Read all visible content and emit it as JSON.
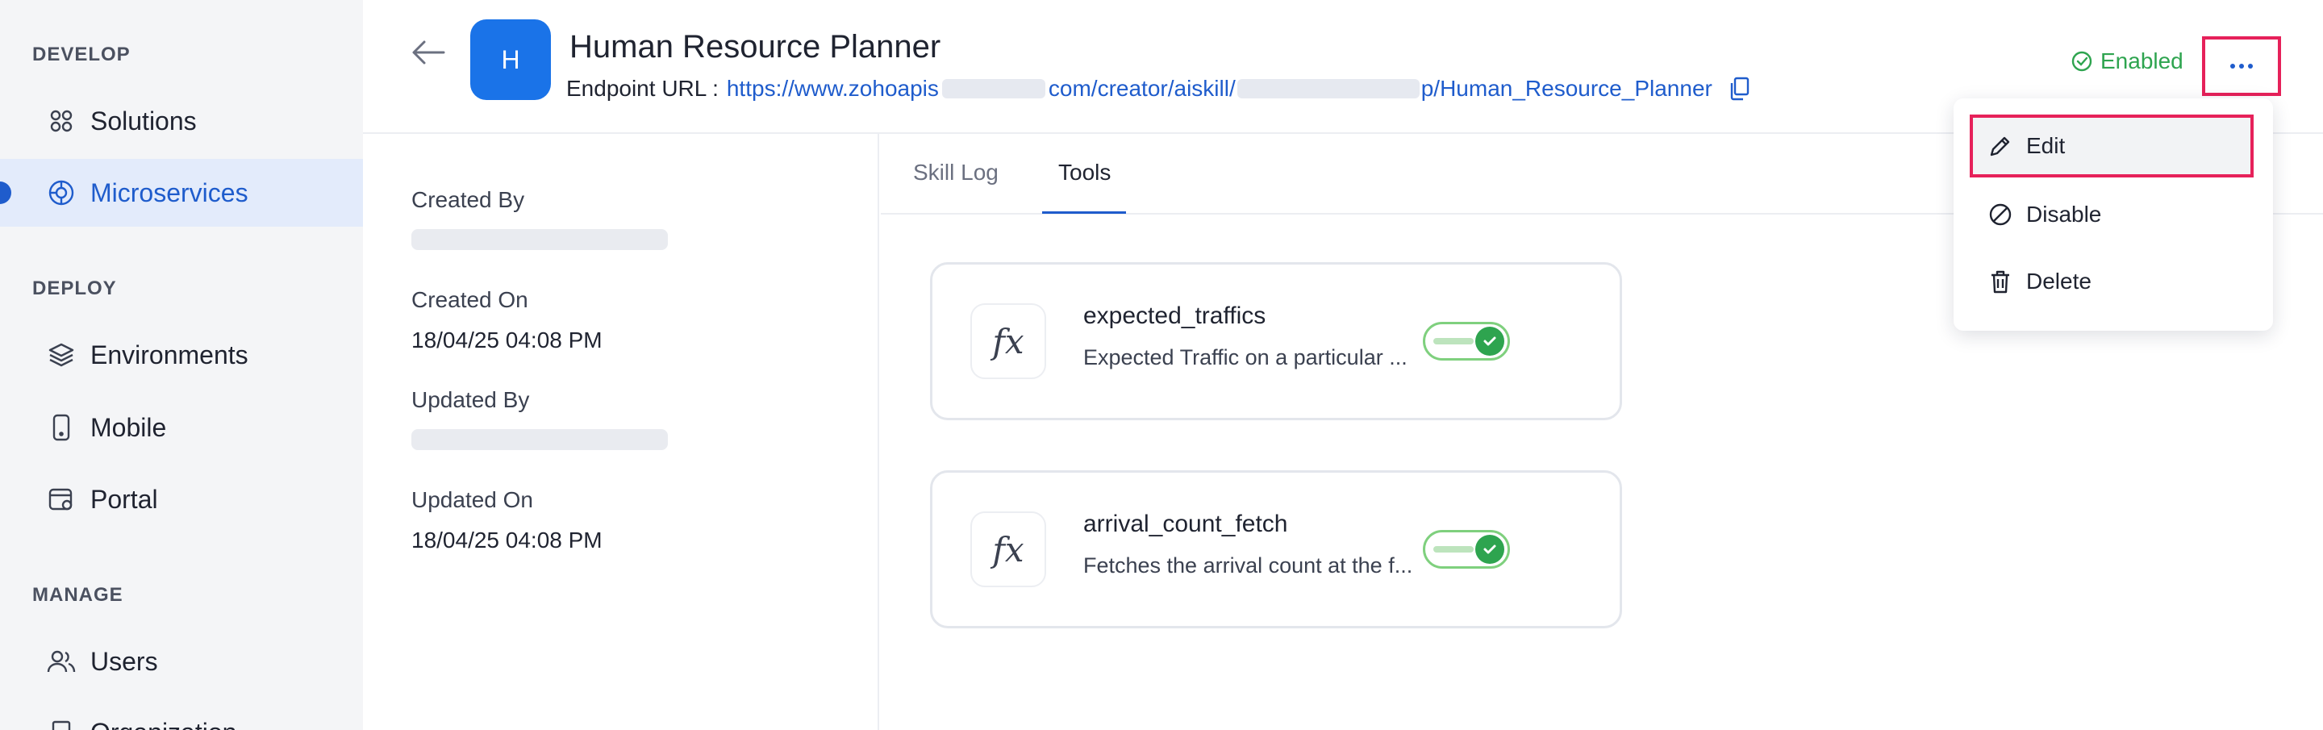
{
  "sidebar": {
    "sections": [
      {
        "title": "DEVELOP"
      },
      {
        "title": "DEPLOY"
      },
      {
        "title": "MANAGE"
      }
    ],
    "items": [
      {
        "label": "Solutions",
        "icon": "grid-icon"
      },
      {
        "label": "Microservices",
        "icon": "microservice-icon",
        "active": true
      },
      {
        "label": "Environments",
        "icon": "layers-icon"
      },
      {
        "label": "Mobile",
        "icon": "mobile-icon"
      },
      {
        "label": "Portal",
        "icon": "portal-icon"
      },
      {
        "label": "Users",
        "icon": "users-icon"
      },
      {
        "label": "Organization",
        "icon": "organization-icon"
      }
    ]
  },
  "header": {
    "avatar_letter": "H",
    "title": "Human Resource Planner",
    "endpoint_label": "Endpoint URL :",
    "url_part1": "https://www.zohoapis",
    "url_part2": "com/creator/aiskill/",
    "url_part3": "p/Human_Resource_Planner",
    "status": "Enabled",
    "more_label": "···"
  },
  "info": {
    "created_by_label": "Created By",
    "created_on_label": "Created On",
    "created_on": "18/04/25 04:08 PM",
    "updated_by_label": "Updated By",
    "updated_on_label": "Updated On",
    "updated_on": "18/04/25 04:08 PM"
  },
  "tabs": [
    {
      "label": "Skill Log",
      "active": false
    },
    {
      "label": "Tools",
      "active": true
    }
  ],
  "tools": [
    {
      "icon_text": "fx",
      "name": "expected_traffics",
      "description": "Expected Traffic on a particular ...",
      "enabled": true
    },
    {
      "icon_text": "fx",
      "name": "arrival_count_fetch",
      "description": "Fetches the arrival count at the f...",
      "enabled": true
    }
  ],
  "menu": {
    "items": [
      {
        "label": "Edit",
        "icon": "pencil-icon"
      },
      {
        "label": "Disable",
        "icon": "disable-icon"
      },
      {
        "label": "Delete",
        "icon": "trash-icon"
      }
    ]
  },
  "colors": {
    "accent": "#1f5ccc",
    "avatar": "#1a73e8",
    "enabled": "#2ea44f",
    "highlight": "#e6215a"
  }
}
